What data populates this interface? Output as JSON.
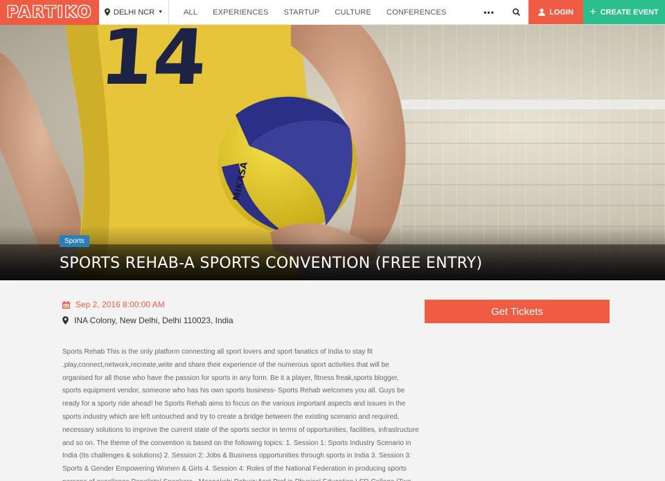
{
  "brand": {
    "logo_text": "PARTIKO"
  },
  "header": {
    "city": "DELHI NCR",
    "nav": [
      "ALL",
      "EXPERIENCES",
      "STARTUP",
      "CULTURE",
      "CONFERENCES"
    ],
    "more": "•••",
    "login": "LOGIN",
    "create": "CREATE EVENT"
  },
  "hero": {
    "category": "Sports",
    "title": "SPORTS REHAB-A SPORTS CONVENTION (FREE ENTRY)",
    "jersey_number": "14",
    "ball_brand": "MIKASA"
  },
  "event": {
    "datetime": "Sep 2, 2016 8:00:00 AM",
    "location": "INA Colony, New Delhi, Delhi 110023, India",
    "cta": "Get Tickets",
    "description": "Sports Rehab This is the only platform connecting all sport lovers and sport fanatics of India to stay fit .play,connect,network,recreate,write and share their experience of the numerous sport activities that will be organised for all those who have the passion for sports in any form. Be it a player, fitness freak,sports blogger, sports equipment vendor, someone who has his own sports business- Sports Rehab welcomes you all. Guys be ready for a sporty ride ahead! he Sports Rehab aims to focus on the various important aspects and issues in the sports industry which are left untouched and try to create a bridge between the existing scenario and required, necessary solutions to improve the current state of the sports sector in terms of opportunities, facilities, infrastructure and so on. The theme of the convention is based on the following topics: 1. Session 1: Sports Industry Scenario in India (Its challenges & solutions) 2. Session 2: Jobs & Business opportunities through sports in India 3. Session 3: Sports & Gender Empowering Women & Girls 4. Session 4: Roles of the National Federation in producing sports persons of excellence Panelists/ Speakers - Meenakshi Pahuja:Asst.Prof in Physical Education LSR College (Two Times Limca Record Holder in Open Swimming)"
  },
  "colors": {
    "brand": "#ef5b43",
    "create": "#2bbf8d",
    "tag": "#2a7fb8"
  },
  "icons": [
    "map-pin-icon",
    "caret-down-icon",
    "search-icon",
    "user-icon",
    "plus-icon",
    "calendar-icon",
    "location-pin-icon"
  ]
}
